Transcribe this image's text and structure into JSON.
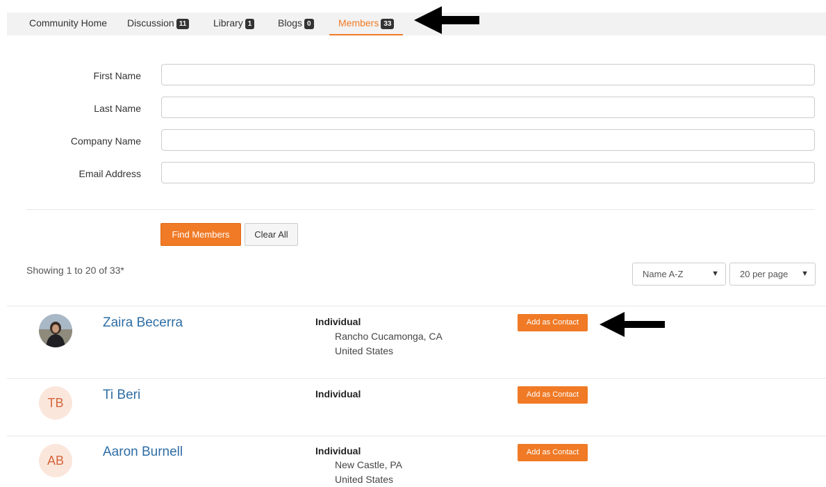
{
  "tabs": [
    {
      "label": "Community Home"
    },
    {
      "label": "Discussion",
      "count": "11"
    },
    {
      "label": "Library",
      "count": "1"
    },
    {
      "label": "Blogs",
      "count": "0"
    },
    {
      "label": "Members",
      "count": "33",
      "active": true
    }
  ],
  "form": {
    "first_name_label": "First Name",
    "last_name_label": "Last Name",
    "company_name_label": "Company Name",
    "email_label": "Email Address",
    "first_name_value": "",
    "last_name_value": "",
    "company_name_value": "",
    "email_value": "",
    "find_button": "Find Members",
    "clear_button": "Clear All"
  },
  "results": {
    "showing": "Showing 1 to 20 of 33*",
    "sort_selected": "Name A-Z",
    "per_page_selected": "20 per page"
  },
  "members": [
    {
      "name": "Zaira Becerra",
      "initials": "",
      "has_photo": true,
      "type": "Individual",
      "city": "Rancho Cucamonga, CA",
      "country": "United States",
      "action": "Add as Contact"
    },
    {
      "name": "Ti Beri",
      "initials": "TB",
      "has_photo": false,
      "type": "Individual",
      "city": "",
      "country": "",
      "action": "Add as Contact"
    },
    {
      "name": "Aaron Burnell",
      "initials": "AB",
      "has_photo": false,
      "type": "Individual",
      "city": "New Castle, PA",
      "country": "United States",
      "action": "Add as Contact"
    }
  ],
  "colors": {
    "accent": "#f07a26",
    "link": "#2e6da4",
    "tabbar_bg": "#f2f2f2",
    "badge_bg": "#333333",
    "avatar_bg": "#fbe6dc",
    "avatar_text": "#d4663b"
  },
  "annotations": {
    "arrow_icons": [
      "arrow-left-icon",
      "arrow-left-icon"
    ]
  }
}
